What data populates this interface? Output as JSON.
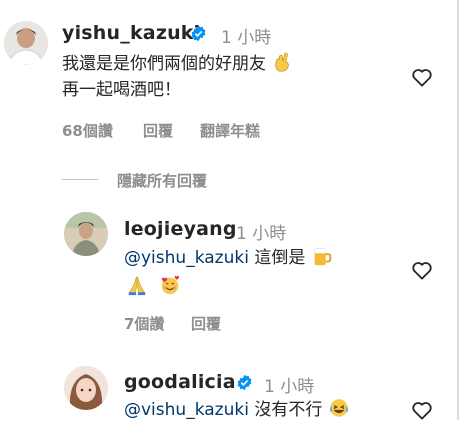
{
  "comments": [
    {
      "username": "yishu_kazuki",
      "verified": true,
      "time": "1 小時",
      "lines": [
        "我還是是你們兩個的好朋友",
        "再一起喝酒吧！"
      ],
      "line1_emoji": "crossed-fingers-emoji",
      "likes": "68個讚",
      "reply": "回覆",
      "translate": "翻譯年糕"
    }
  ],
  "hide_replies": "隱藏所有回覆",
  "replies": [
    {
      "username": "leojieyang",
      "time": "1 小時",
      "mention": "@yishu_kazuki",
      "text": "這倒是",
      "emojis": [
        "beer-mug-emoji",
        "folded-hands-emoji",
        "smiling-face-with-hearts-emoji"
      ],
      "likes": "7個讚",
      "reply": "回覆"
    },
    {
      "username": "goodalicia",
      "verified": true,
      "time": "1 小時",
      "mention": "@vishu_kazuki",
      "text": "沒有不行",
      "emojis": [
        "rolling-laughing-emoji"
      ]
    }
  ],
  "colors": {
    "verified": "#0095f6",
    "mention": "#00376b",
    "muted": "#8e8e8e"
  }
}
